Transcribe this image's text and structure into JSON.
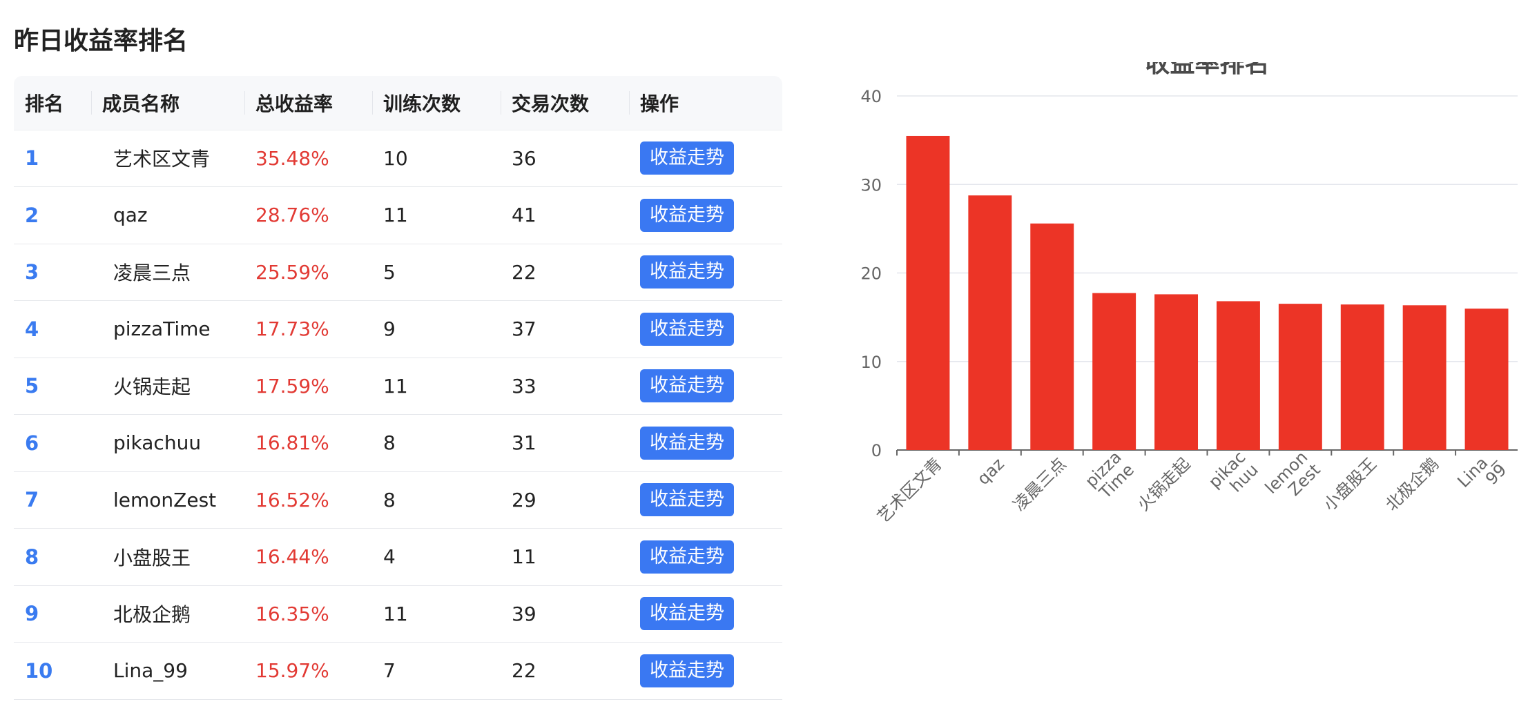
{
  "section_title": "昨日收益率排名",
  "table": {
    "columns": [
      "排名",
      "成员名称",
      "总收益率",
      "训练次数",
      "交易次数",
      "操作"
    ],
    "rows": [
      {
        "rank": "1",
        "member": "艺术区文青",
        "rate": "35.48%",
        "trainings": "10",
        "trades": "36",
        "action": "收益走势"
      },
      {
        "rank": "2",
        "member": "qaz",
        "rate": "28.76%",
        "trainings": "11",
        "trades": "41",
        "action": "收益走势"
      },
      {
        "rank": "3",
        "member": "凌晨三点",
        "rate": "25.59%",
        "trainings": "5",
        "trades": "22",
        "action": "收益走势"
      },
      {
        "rank": "4",
        "member": "pizzaTime",
        "rate": "17.73%",
        "trainings": "9",
        "trades": "37",
        "action": "收益走势"
      },
      {
        "rank": "5",
        "member": "火锅走起",
        "rate": "17.59%",
        "trainings": "11",
        "trades": "33",
        "action": "收益走势"
      },
      {
        "rank": "6",
        "member": "pikachuu",
        "rate": "16.81%",
        "trainings": "8",
        "trades": "31",
        "action": "收益走势"
      },
      {
        "rank": "7",
        "member": "lemonZest",
        "rate": "16.52%",
        "trainings": "8",
        "trades": "29",
        "action": "收益走势"
      },
      {
        "rank": "8",
        "member": "小盘股王",
        "rate": "16.44%",
        "trainings": "4",
        "trades": "11",
        "action": "收益走势"
      },
      {
        "rank": "9",
        "member": "北极企鹅",
        "rate": "16.35%",
        "trainings": "11",
        "trades": "39",
        "action": "收益走势"
      },
      {
        "rank": "10",
        "member": "Lina_99",
        "rate": "15.97%",
        "trainings": "7",
        "trades": "22",
        "action": "收益走势"
      }
    ]
  },
  "colors": {
    "accent": "#3a78f2",
    "rank_text": "#3a7bf0",
    "rate_text": "#e23a34",
    "bar": "#ec3426"
  },
  "chart_data": {
    "type": "bar",
    "title": "收益率排名",
    "categories": [
      "艺术区文青",
      "qaz",
      "凌晨三点",
      "pizza\nTime",
      "火锅走起",
      "pikac\nhuu",
      "lemon\nZest",
      "小盘股王",
      "北极企鹅",
      "Lina_\n99"
    ],
    "values": [
      35.48,
      28.76,
      25.59,
      17.73,
      17.59,
      16.81,
      16.52,
      16.44,
      16.35,
      15.97
    ],
    "yticks": [
      "0",
      "10",
      "20",
      "30",
      "40"
    ],
    "ylim": [
      0,
      40
    ],
    "xlabel": "",
    "ylabel": "",
    "grid": true,
    "legend": "none"
  }
}
